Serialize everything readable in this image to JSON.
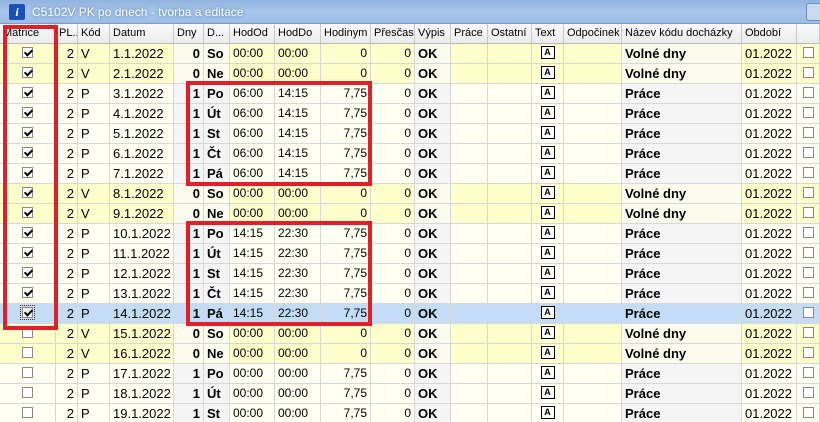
{
  "window": {
    "title": "C5102V PK po dnech - tvorba a editace"
  },
  "columns": {
    "matrice": "Matrice",
    "pl": "PL...",
    "kod": "Kód",
    "datum": "Datum",
    "dny": "Dny",
    "d": "D...",
    "hododd": "HodOd",
    "hoddo": "HodDo",
    "hodinym": "Hodinym",
    "prescas": "Přesčas",
    "vypis": "Výpis",
    "prace": "Práce",
    "ostatni": "Ostatní",
    "text": "Text",
    "odpocinek": "Odpočinek",
    "nazev": "Název kódu docházky",
    "obdobi": "Období"
  },
  "rows": [
    {
      "checked": true,
      "pl": "2",
      "kod": "V",
      "datum": "1.1.2022",
      "dny": "0",
      "d": "So",
      "od": "00:00",
      "do": "00:00",
      "hod": "0",
      "pre": "0",
      "vyp": "OK",
      "naz": "Volné dny",
      "obd": "01.2022",
      "type": "weekend"
    },
    {
      "checked": true,
      "pl": "2",
      "kod": "V",
      "datum": "2.1.2022",
      "dny": "0",
      "d": "Ne",
      "od": "00:00",
      "do": "00:00",
      "hod": "0",
      "pre": "0",
      "vyp": "OK",
      "naz": "Volné dny",
      "obd": "01.2022",
      "type": "weekend"
    },
    {
      "checked": true,
      "pl": "2",
      "kod": "P",
      "datum": "3.1.2022",
      "dny": "1",
      "d": "Po",
      "od": "06:00",
      "do": "14:15",
      "hod": "7,75",
      "pre": "0",
      "vyp": "OK",
      "naz": "Práce",
      "obd": "01.2022",
      "type": "normal"
    },
    {
      "checked": true,
      "pl": "2",
      "kod": "P",
      "datum": "4.1.2022",
      "dny": "1",
      "d": "Út",
      "od": "06:00",
      "do": "14:15",
      "hod": "7,75",
      "pre": "0",
      "vyp": "OK",
      "naz": "Práce",
      "obd": "01.2022",
      "type": "normal"
    },
    {
      "checked": true,
      "pl": "2",
      "kod": "P",
      "datum": "5.1.2022",
      "dny": "1",
      "d": "St",
      "od": "06:00",
      "do": "14:15",
      "hod": "7,75",
      "pre": "0",
      "vyp": "OK",
      "naz": "Práce",
      "obd": "01.2022",
      "type": "normal"
    },
    {
      "checked": true,
      "pl": "2",
      "kod": "P",
      "datum": "6.1.2022",
      "dny": "1",
      "d": "Čt",
      "od": "06:00",
      "do": "14:15",
      "hod": "7,75",
      "pre": "0",
      "vyp": "OK",
      "naz": "Práce",
      "obd": "01.2022",
      "type": "normal"
    },
    {
      "checked": true,
      "pl": "2",
      "kod": "P",
      "datum": "7.1.2022",
      "dny": "1",
      "d": "Pá",
      "od": "06:00",
      "do": "14:15",
      "hod": "7,75",
      "pre": "0",
      "vyp": "OK",
      "naz": "Práce",
      "obd": "01.2022",
      "type": "normal"
    },
    {
      "checked": true,
      "pl": "2",
      "kod": "V",
      "datum": "8.1.2022",
      "dny": "0",
      "d": "So",
      "od": "00:00",
      "do": "00:00",
      "hod": "0",
      "pre": "0",
      "vyp": "OK",
      "naz": "Volné dny",
      "obd": "01.2022",
      "type": "weekend"
    },
    {
      "checked": true,
      "pl": "2",
      "kod": "V",
      "datum": "9.1.2022",
      "dny": "0",
      "d": "Ne",
      "od": "00:00",
      "do": "00:00",
      "hod": "0",
      "pre": "0",
      "vyp": "OK",
      "naz": "Volné dny",
      "obd": "01.2022",
      "type": "weekend"
    },
    {
      "checked": true,
      "pl": "2",
      "kod": "P",
      "datum": "10.1.2022",
      "dny": "1",
      "d": "Po",
      "od": "14:15",
      "do": "22:30",
      "hod": "7,75",
      "pre": "0",
      "vyp": "OK",
      "naz": "Práce",
      "obd": "01.2022",
      "type": "normal"
    },
    {
      "checked": true,
      "pl": "2",
      "kod": "P",
      "datum": "11.1.2022",
      "dny": "1",
      "d": "Út",
      "od": "14:15",
      "do": "22:30",
      "hod": "7,75",
      "pre": "0",
      "vyp": "OK",
      "naz": "Práce",
      "obd": "01.2022",
      "type": "normal"
    },
    {
      "checked": true,
      "pl": "2",
      "kod": "P",
      "datum": "12.1.2022",
      "dny": "1",
      "d": "St",
      "od": "14:15",
      "do": "22:30",
      "hod": "7,75",
      "pre": "0",
      "vyp": "OK",
      "naz": "Práce",
      "obd": "01.2022",
      "type": "normal"
    },
    {
      "checked": true,
      "pl": "2",
      "kod": "P",
      "datum": "13.1.2022",
      "dny": "1",
      "d": "Čt",
      "od": "14:15",
      "do": "22:30",
      "hod": "7,75",
      "pre": "0",
      "vyp": "OK",
      "naz": "Práce",
      "obd": "01.2022",
      "type": "normal"
    },
    {
      "checked": true,
      "pl": "2",
      "kod": "P",
      "datum": "14.1.2022",
      "dny": "1",
      "d": "Pá",
      "od": "14:15",
      "do": "22:30",
      "hod": "7,75",
      "pre": "0",
      "vyp": "OK",
      "naz": "Práce",
      "obd": "01.2022",
      "type": "selected"
    },
    {
      "checked": false,
      "pl": "2",
      "kod": "V",
      "datum": "15.1.2022",
      "dny": "0",
      "d": "So",
      "od": "00:00",
      "do": "00:00",
      "hod": "0",
      "pre": "0",
      "vyp": "OK",
      "naz": "Volné dny",
      "obd": "01.2022",
      "type": "weekend"
    },
    {
      "checked": false,
      "pl": "2",
      "kod": "V",
      "datum": "16.1.2022",
      "dny": "0",
      "d": "Ne",
      "od": "00:00",
      "do": "00:00",
      "hod": "0",
      "pre": "0",
      "vyp": "OK",
      "naz": "Volné dny",
      "obd": "01.2022",
      "type": "weekend"
    },
    {
      "checked": false,
      "pl": "2",
      "kod": "P",
      "datum": "17.1.2022",
      "dny": "1",
      "d": "Po",
      "od": "00:00",
      "do": "00:00",
      "hod": "7,75",
      "pre": "0",
      "vyp": "OK",
      "naz": "Práce",
      "obd": "01.2022",
      "type": "normal"
    },
    {
      "checked": false,
      "pl": "2",
      "kod": "P",
      "datum": "18.1.2022",
      "dny": "1",
      "d": "Út",
      "od": "00:00",
      "do": "00:00",
      "hod": "7,75",
      "pre": "0",
      "vyp": "OK",
      "naz": "Práce",
      "obd": "01.2022",
      "type": "normal"
    },
    {
      "checked": false,
      "pl": "2",
      "kod": "P",
      "datum": "19.1.2022",
      "dny": "1",
      "d": "St",
      "od": "00:00",
      "do": "00:00",
      "hod": "7,75",
      "pre": "0",
      "vyp": "OK",
      "naz": "Práce",
      "obd": "01.2022",
      "type": "normal"
    }
  ],
  "colors": {
    "highlight_red": "#e01f2a",
    "weekend_bg": "#ffffcc",
    "selected_bg": "#c4dcf6"
  },
  "icons": {
    "text_cell": "text-note-icon",
    "title": "info-icon"
  }
}
